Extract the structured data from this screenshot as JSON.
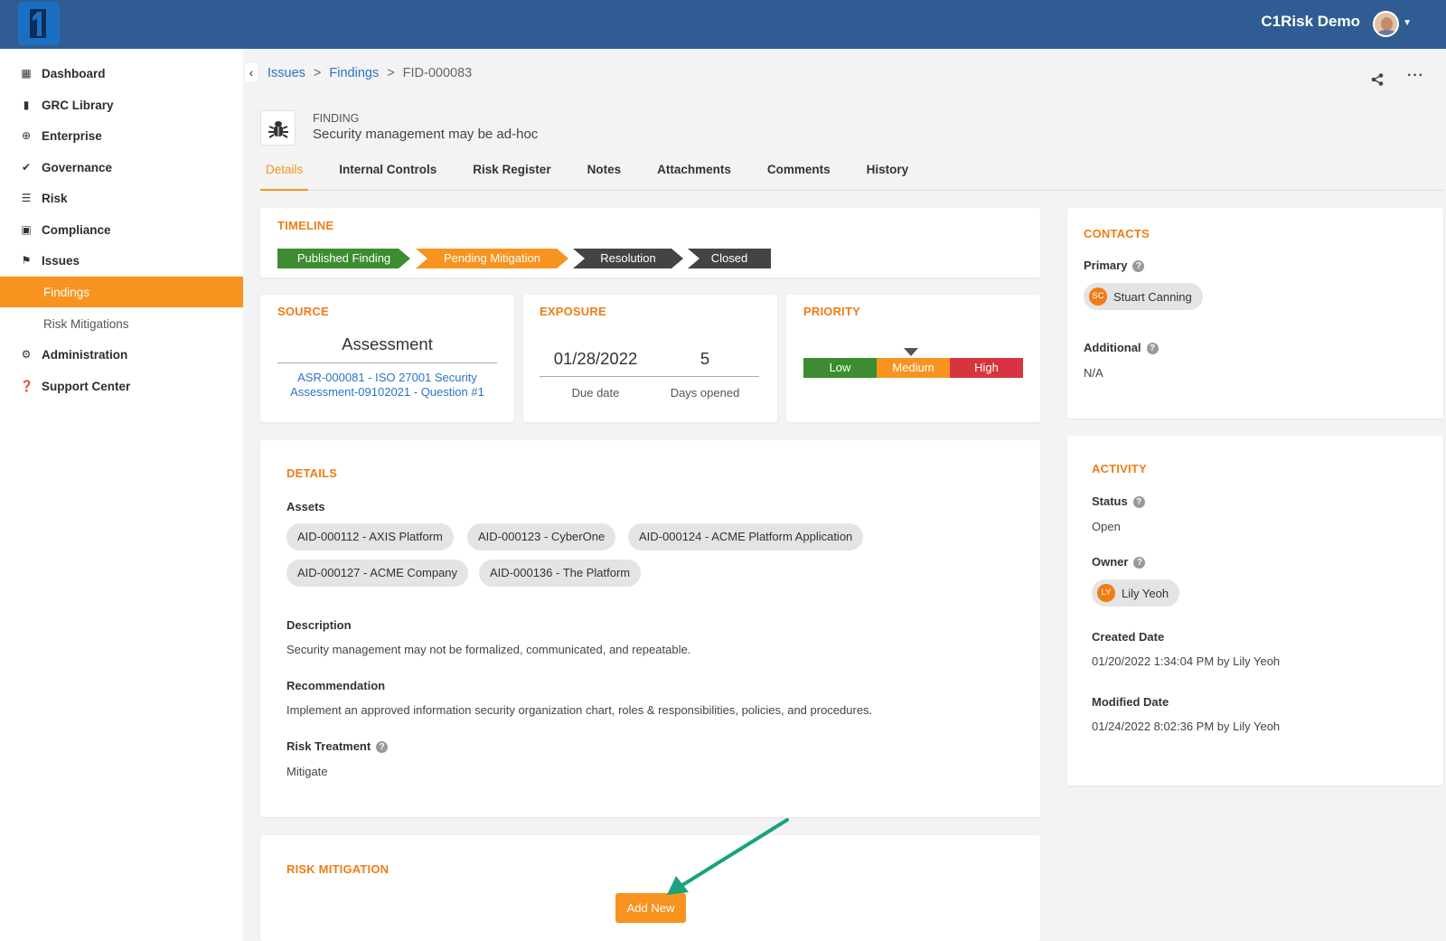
{
  "header": {
    "app_name": "C1Risk Demo"
  },
  "sidebar": {
    "items": [
      {
        "label": "Dashboard",
        "icon": "dashboard-icon"
      },
      {
        "label": "GRC Library",
        "icon": "book-icon"
      },
      {
        "label": "Enterprise",
        "icon": "globe-icon"
      },
      {
        "label": "Governance",
        "icon": "double-check-icon"
      },
      {
        "label": "Risk",
        "icon": "list-icon"
      },
      {
        "label": "Compliance",
        "icon": "clipboard-check-icon"
      },
      {
        "label": "Issues",
        "icon": "flag-icon"
      },
      {
        "label": "Findings",
        "icon": ""
      },
      {
        "label": "Risk Mitigations",
        "icon": ""
      },
      {
        "label": "Administration",
        "icon": "gear-icon"
      },
      {
        "label": "Support Center",
        "icon": "question-circle-icon"
      }
    ],
    "active": "Findings"
  },
  "breadcrumb": {
    "issues": "Issues",
    "sep": ">",
    "findings": "Findings",
    "current": "FID-000083"
  },
  "record": {
    "type": "FINDING",
    "title": "Security management may be ad-hoc"
  },
  "tabs": [
    "Details",
    "Internal Controls",
    "Risk Register",
    "Notes",
    "Attachments",
    "Comments",
    "History"
  ],
  "timeline": {
    "title": "TIMELINE",
    "steps": [
      {
        "label": "Published Finding",
        "color": "#3c8d2f"
      },
      {
        "label": "Pending Mitigation",
        "color": "#f7931e"
      },
      {
        "label": "Resolution",
        "color": "#444444"
      },
      {
        "label": "Closed",
        "color": "#444444"
      }
    ]
  },
  "source": {
    "title": "SOURCE",
    "value": "Assessment",
    "link": "ASR-000081 - ISO 27001 Security Assessment-09102021 - Question #1"
  },
  "exposure": {
    "title": "EXPOSURE",
    "due_date": "01/28/2022",
    "days_opened": "5",
    "due_label": "Due date",
    "days_label": "Days opened"
  },
  "priority": {
    "title": "PRIORITY",
    "levels": [
      "Low",
      "Medium",
      "High"
    ],
    "selected": "Medium",
    "colors": [
      "#3c8d2f",
      "#f7931e",
      "#d8343f"
    ]
  },
  "contacts": {
    "title": "CONTACTS",
    "primary_label": "Primary",
    "primary": {
      "initials": "SC",
      "name": "Stuart Canning"
    },
    "additional_label": "Additional",
    "additional": "N/A"
  },
  "details": {
    "title": "DETAILS",
    "assets_label": "Assets",
    "assets": [
      "AID-000112 - AXIS Platform",
      "AID-000123 - CyberOne",
      "AID-000124 - ACME Platform Application",
      "AID-000127 - ACME Company",
      "AID-000136 - The Platform"
    ],
    "description_label": "Description",
    "description": "Security management may not be formalized, communicated, and repeatable.",
    "recommendation_label": "Recommendation",
    "recommendation": "Implement an approved information security organization chart, roles & responsibilities, policies, and procedures.",
    "treatment_label": "Risk Treatment",
    "treatment": "Mitigate"
  },
  "activity": {
    "title": "ACTIVITY",
    "status_label": "Status",
    "status": "Open",
    "owner_label": "Owner",
    "owner": {
      "initials": "LY",
      "name": "Lily Yeoh"
    },
    "created_label": "Created Date",
    "created": "01/20/2022 1:34:04 PM by Lily Yeoh",
    "modified_label": "Modified Date",
    "modified": "01/24/2022 8:02:36 PM by Lily Yeoh"
  },
  "mitigation": {
    "title": "RISK MITIGATION",
    "add_label": "Add New"
  },
  "help_glyph": "?"
}
